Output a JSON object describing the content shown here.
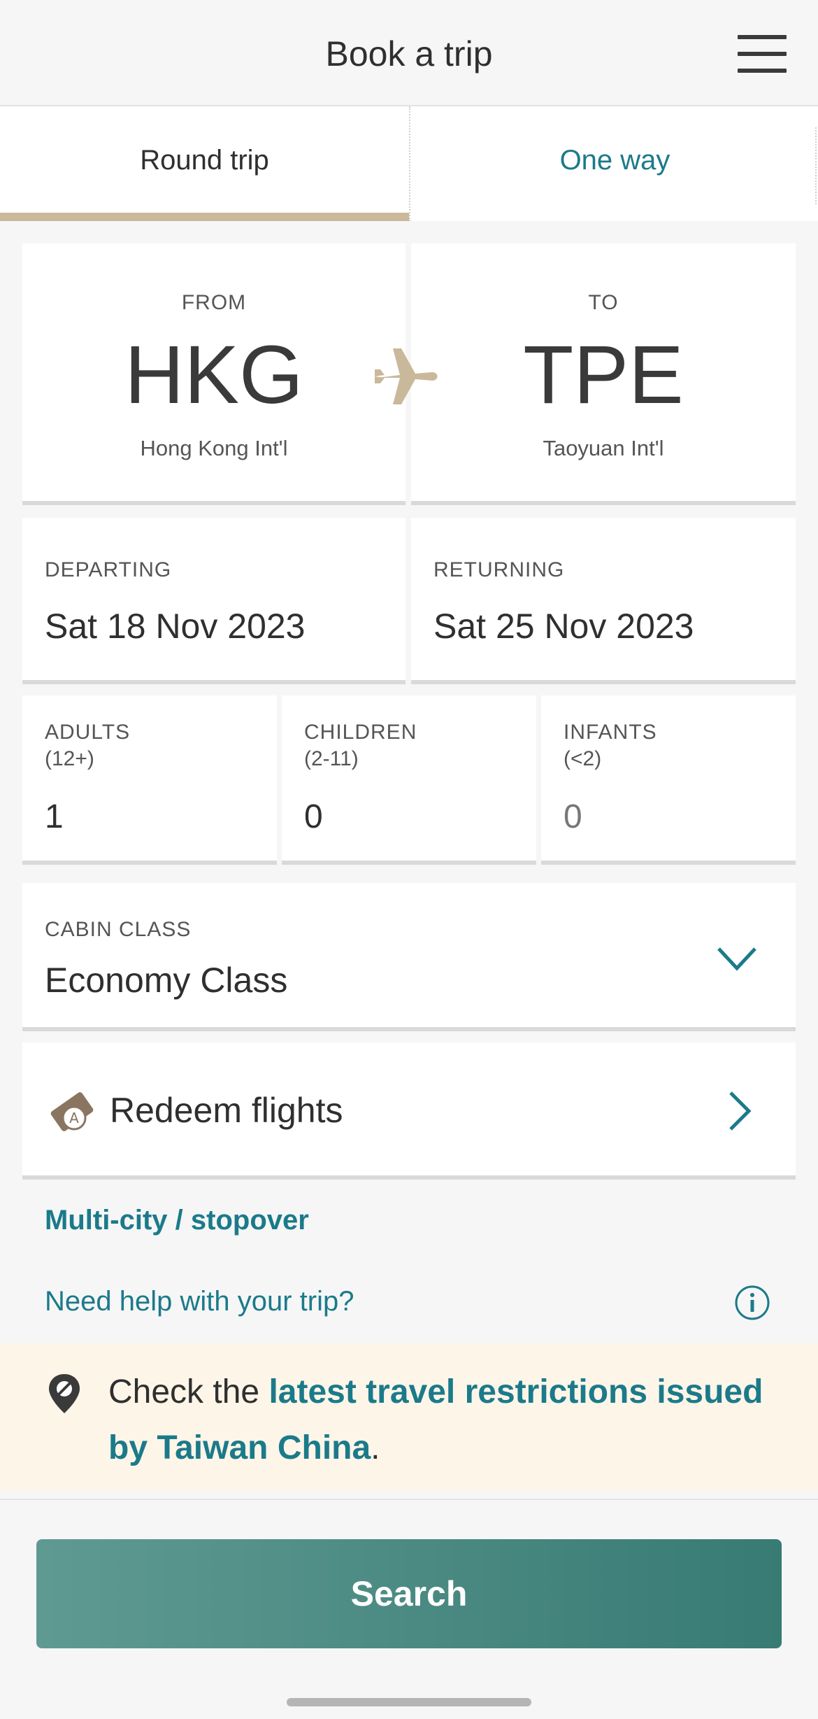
{
  "header": {
    "title": "Book a trip"
  },
  "tabs": [
    {
      "label": "Round trip",
      "selected": true
    },
    {
      "label": "One way",
      "selected": false
    }
  ],
  "route": {
    "from": {
      "label": "FROM",
      "code": "HKG",
      "airport": "Hong Kong Int'l"
    },
    "to": {
      "label": "TO",
      "code": "TPE",
      "airport": "Taoyuan Int'l"
    }
  },
  "dates": {
    "departing": {
      "label": "DEPARTING",
      "value": "Sat 18 Nov 2023"
    },
    "returning": {
      "label": "RETURNING",
      "value": "Sat 25 Nov 2023"
    }
  },
  "passengers": {
    "adults": {
      "label": "ADULTS",
      "range": "(12+)",
      "value": "1"
    },
    "children": {
      "label": "CHILDREN",
      "range": "(2-11)",
      "value": "0"
    },
    "infants": {
      "label": "INFANTS",
      "range": "(<2)",
      "value": "0"
    }
  },
  "cabin": {
    "label": "CABIN CLASS",
    "value": "Economy Class"
  },
  "redeem": {
    "label": "Redeem flights"
  },
  "links": {
    "multi_city": "Multi-city / stopover",
    "help": "Need help with your trip?"
  },
  "notice": {
    "prefix": "Check the ",
    "link": "latest travel restrictions issued by Taiwan China",
    "suffix": "."
  },
  "search": {
    "label": "Search"
  },
  "colors": {
    "accent_teal": "#1b7a8a",
    "gold": "#c9b89a",
    "search_button": "#4a8a83",
    "notice_bg": "#fdf5e8"
  },
  "icons": [
    "menu-icon",
    "plane-icon",
    "chevron-down-icon",
    "redeem-ticket-icon",
    "chevron-right-icon",
    "info-icon",
    "location-off-icon"
  ]
}
